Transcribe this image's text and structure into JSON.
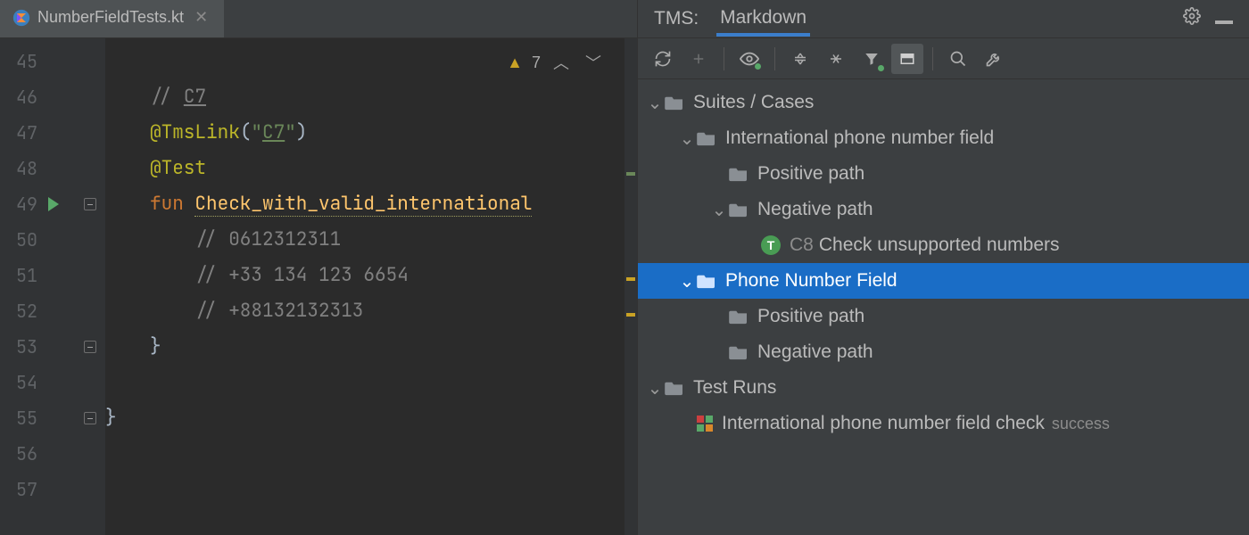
{
  "editor": {
    "tab_file_name": "NumberFieldTests.kt",
    "inspection_count": "7",
    "lines_start": 45,
    "lines": [
      {
        "n": 45,
        "segs": []
      },
      {
        "n": 46,
        "segs": [
          {
            "cls": "c-comment",
            "txt": "// "
          },
          {
            "cls": "c-link",
            "txt": "C7"
          }
        ]
      },
      {
        "n": 47,
        "segs": [
          {
            "cls": "c-annotation",
            "txt": "@TmsLink"
          },
          {
            "cls": "",
            "txt": "("
          },
          {
            "cls": "c-string",
            "txt": "\""
          },
          {
            "cls": "c-linkstr",
            "txt": "C7"
          },
          {
            "cls": "c-string",
            "txt": "\""
          },
          {
            "cls": "",
            "txt": ")"
          }
        ]
      },
      {
        "n": 48,
        "segs": [
          {
            "cls": "c-annotation",
            "txt": "@Test"
          }
        ]
      },
      {
        "n": 49,
        "run": true,
        "fold": true,
        "segs": [
          {
            "cls": "c-keyword",
            "txt": "fun "
          },
          {
            "cls": "c-funcname",
            "txt": "Check_with_valid_international"
          }
        ]
      },
      {
        "n": 50,
        "segs": [
          {
            "cls": "",
            "txt": "    "
          },
          {
            "cls": "c-comment",
            "txt": "// 0612312311"
          }
        ]
      },
      {
        "n": 51,
        "segs": [
          {
            "cls": "",
            "txt": "    "
          },
          {
            "cls": "c-comment",
            "txt": "// +33 134 123 6654"
          }
        ]
      },
      {
        "n": 52,
        "segs": [
          {
            "cls": "",
            "txt": "    "
          },
          {
            "cls": "c-comment",
            "txt": "// +88132132313"
          }
        ]
      },
      {
        "n": 53,
        "fold": true,
        "segs": [
          {
            "cls": "",
            "txt": "}"
          }
        ]
      },
      {
        "n": 54,
        "segs": []
      },
      {
        "n": 55,
        "fold": true,
        "dedent": true,
        "segs": [
          {
            "cls": "",
            "txt": "}"
          }
        ]
      },
      {
        "n": 56,
        "segs": []
      },
      {
        "n": 57,
        "segs": []
      }
    ]
  },
  "tms": {
    "panel_label": "TMS:",
    "active_tab": "Markdown",
    "tree": [
      {
        "depth": 0,
        "kind": "folder",
        "expanded": true,
        "label": "Suites / Cases"
      },
      {
        "depth": 1,
        "kind": "folder",
        "expanded": true,
        "label": "International phone number field"
      },
      {
        "depth": 2,
        "kind": "folder",
        "expanded": null,
        "label": "Positive path"
      },
      {
        "depth": 2,
        "kind": "folder",
        "expanded": true,
        "label": "Negative path"
      },
      {
        "depth": 3,
        "kind": "case",
        "case_id": "C8",
        "label": "Check unsupported numbers"
      },
      {
        "depth": 1,
        "kind": "folder",
        "expanded": true,
        "label": "Phone Number Field",
        "selected": true
      },
      {
        "depth": 2,
        "kind": "folder",
        "expanded": null,
        "label": "Positive path"
      },
      {
        "depth": 2,
        "kind": "folder",
        "expanded": null,
        "label": "Negative path"
      },
      {
        "depth": 0,
        "kind": "folder",
        "expanded": true,
        "label": "Test Runs"
      },
      {
        "depth": 1,
        "kind": "run",
        "label": "International phone number field check",
        "status": "success"
      }
    ]
  }
}
